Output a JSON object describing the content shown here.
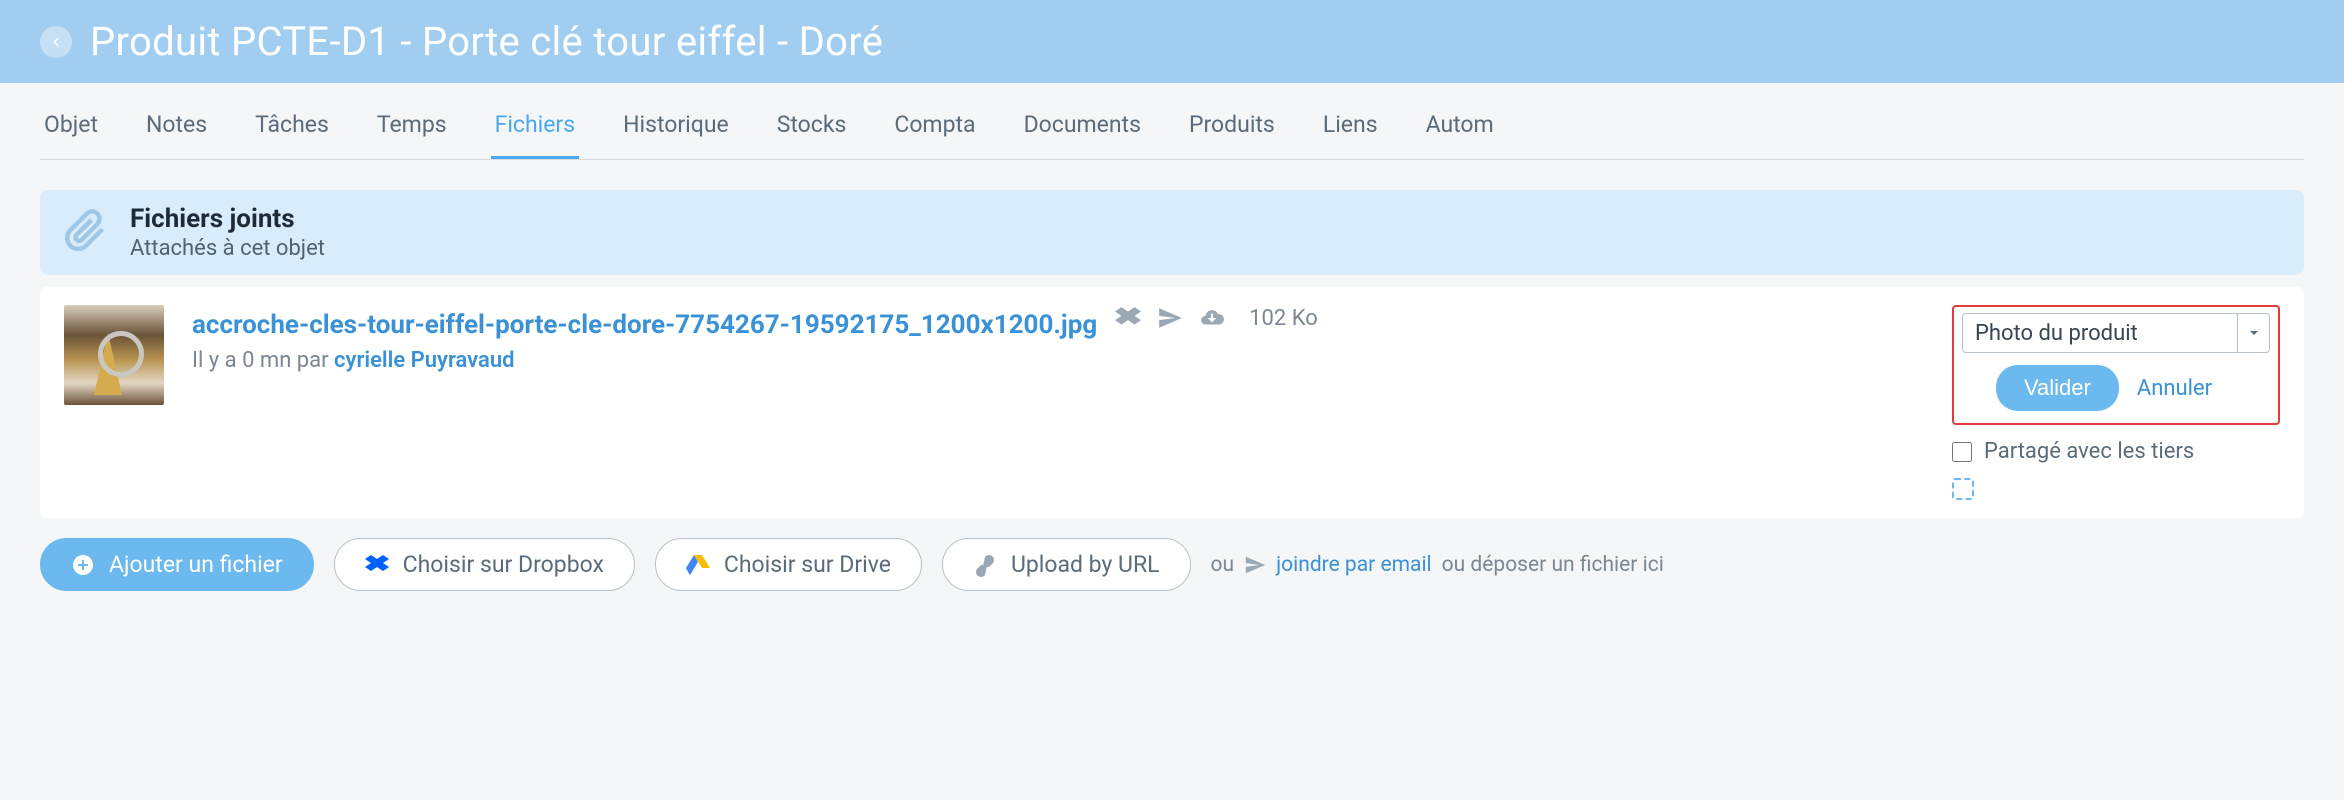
{
  "header": {
    "title": "Produit PCTE-D1 - Porte clé tour eiffel - Doré"
  },
  "tabs": [
    "Objet",
    "Notes",
    "Tâches",
    "Temps",
    "Fichiers",
    "Historique",
    "Stocks",
    "Compta",
    "Documents",
    "Produits",
    "Liens",
    "Autom"
  ],
  "activeTabIndex": 4,
  "section": {
    "title": "Fichiers joints",
    "subtitle": "Attachés à cet objet"
  },
  "file": {
    "name": "accroche-cles-tour-eiffel-porte-cle-dore-7754267-19592175_1200x1200.jpg",
    "size": "102 Ko",
    "meta_prefix": "Il y a 0 mn par ",
    "author": "cyrielle Puyravaud"
  },
  "controls": {
    "dropdown_value": "Photo du produit",
    "validate": "Valider",
    "cancel": "Annuler",
    "share_label": "Partagé avec les tiers"
  },
  "footer": {
    "add": "Ajouter un fichier",
    "dropbox": "Choisir sur Dropbox",
    "drive": "Choisir sur Drive",
    "url": "Upload by URL",
    "or": "ou",
    "email_link": "joindre par email",
    "or_drop": "ou déposer un fichier ici"
  }
}
